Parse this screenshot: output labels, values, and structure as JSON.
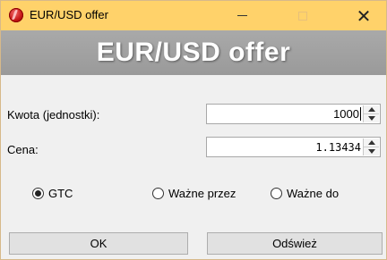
{
  "window": {
    "title": "EUR/USD offer",
    "minimize_icon": "minimize-icon",
    "maximize_icon": "maximize-icon",
    "close_icon": "close-icon",
    "close_glyph": "✕"
  },
  "banner": {
    "title": "EUR/USD offer"
  },
  "form": {
    "amount_label": "Kwota (jednostki):",
    "amount_value": "1000",
    "price_label": "Cena:",
    "price_value": "1.13434"
  },
  "validity": {
    "options": [
      {
        "label": "GTC",
        "checked": true
      },
      {
        "label": "Ważne przez",
        "checked": false
      },
      {
        "label": "Ważne do",
        "checked": false
      }
    ]
  },
  "buttons": {
    "ok_label": "OK",
    "refresh_label": "Odśwież"
  },
  "colors": {
    "titlebar": "#ffd26a",
    "banner": "#a3a3a3",
    "panel": "#f0f0f0"
  }
}
